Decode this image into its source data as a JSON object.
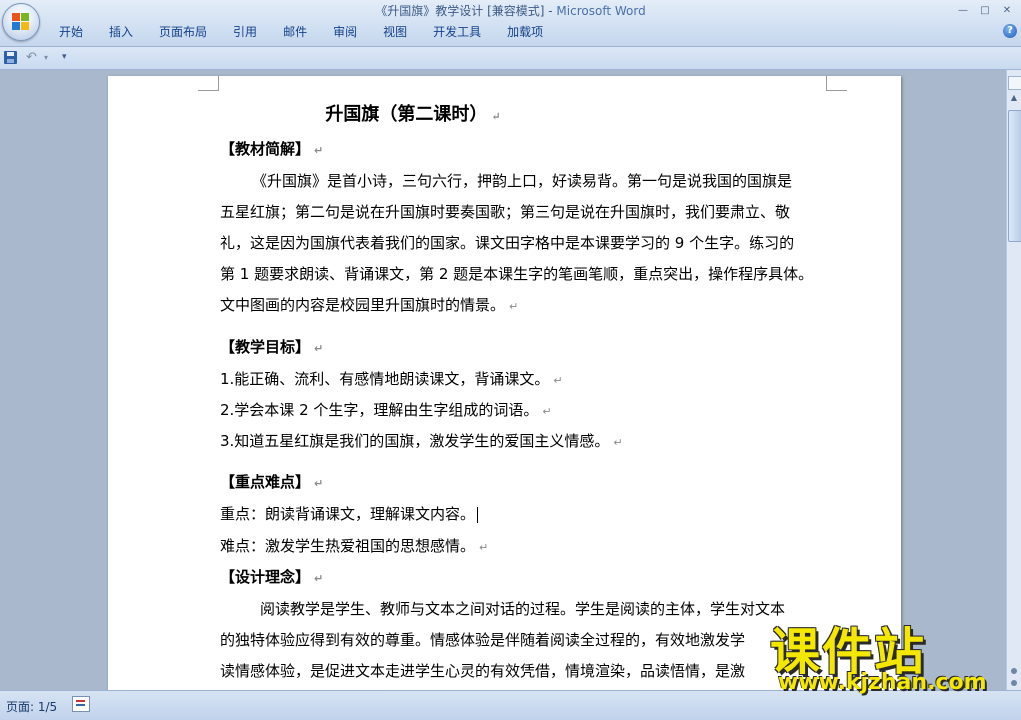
{
  "window": {
    "title": "《升国旗》教学设计 [兼容模式] - ",
    "app_name": "Microsoft Word",
    "controls": [
      "—",
      "□",
      "✕"
    ]
  },
  "ribbon": {
    "tabs": [
      "开始",
      "插入",
      "页面布局",
      "引用",
      "邮件",
      "审阅",
      "视图",
      "开发工具",
      "加载项"
    ],
    "help": "?"
  },
  "qat": {
    "save_icon": "save-icon",
    "undo_icon": "undo-icon",
    "undo_glyph": "↶",
    "dropdown_glyph": "▾",
    "more_glyph": "▾"
  },
  "document": {
    "title": "升国旗（第二课时）",
    "paragraph_mark": "↵",
    "sections": {
      "textbook_heading": "【教材简解】",
      "textbook_lines": [
        "《升国旗》是首小诗，三句六行，押韵上口，好读易背。第一句是说我国的国旗是",
        "五星红旗；第二句是说在升国旗时要奏国歌；第三句是说在升国旗时，我们要肃立、敬",
        "礼，这是因为国旗代表着我们的国家。课文田字格中是本课要学习的 9 个生字。练习的",
        "第 1 题要求朗读、背诵课文，第 2 题是本课生字的笔画笔顺，重点突出，操作程序具体。",
        "文中图画的内容是校园里升国旗时的情景。"
      ],
      "goals_heading": "【教学目标】",
      "goals": [
        "1.能正确、流利、有感情地朗读课文，背诵课文。",
        "2.学会本课 2 个生字，理解由生字组成的词语。",
        "3.知道五星红旗是我们的国旗，激发学生的爱国主义情感。"
      ],
      "key_heading": "【重点难点】",
      "key_point": "重点：朗读背诵课文，理解课文内容。",
      "difficulty": "难点：激发学生热爱祖国的思想感情。",
      "design_heading": "【设计理念】",
      "design_lines": [
        "阅读教学是学生、教师与文本之间对话的过程。学生是阅读的主体，学生对文本",
        "的独特体验应得到有效的尊重。情感体验是伴随着阅读全过程的，有效地激发学",
        "读情感体验，是促进文本走进学生心灵的有效凭借，情境渲染，品读悟情，是激"
      ]
    }
  },
  "status": {
    "page": "页面: 1/5"
  },
  "watermark": {
    "name": "课件站",
    "url": "www.kjzhan.com"
  }
}
